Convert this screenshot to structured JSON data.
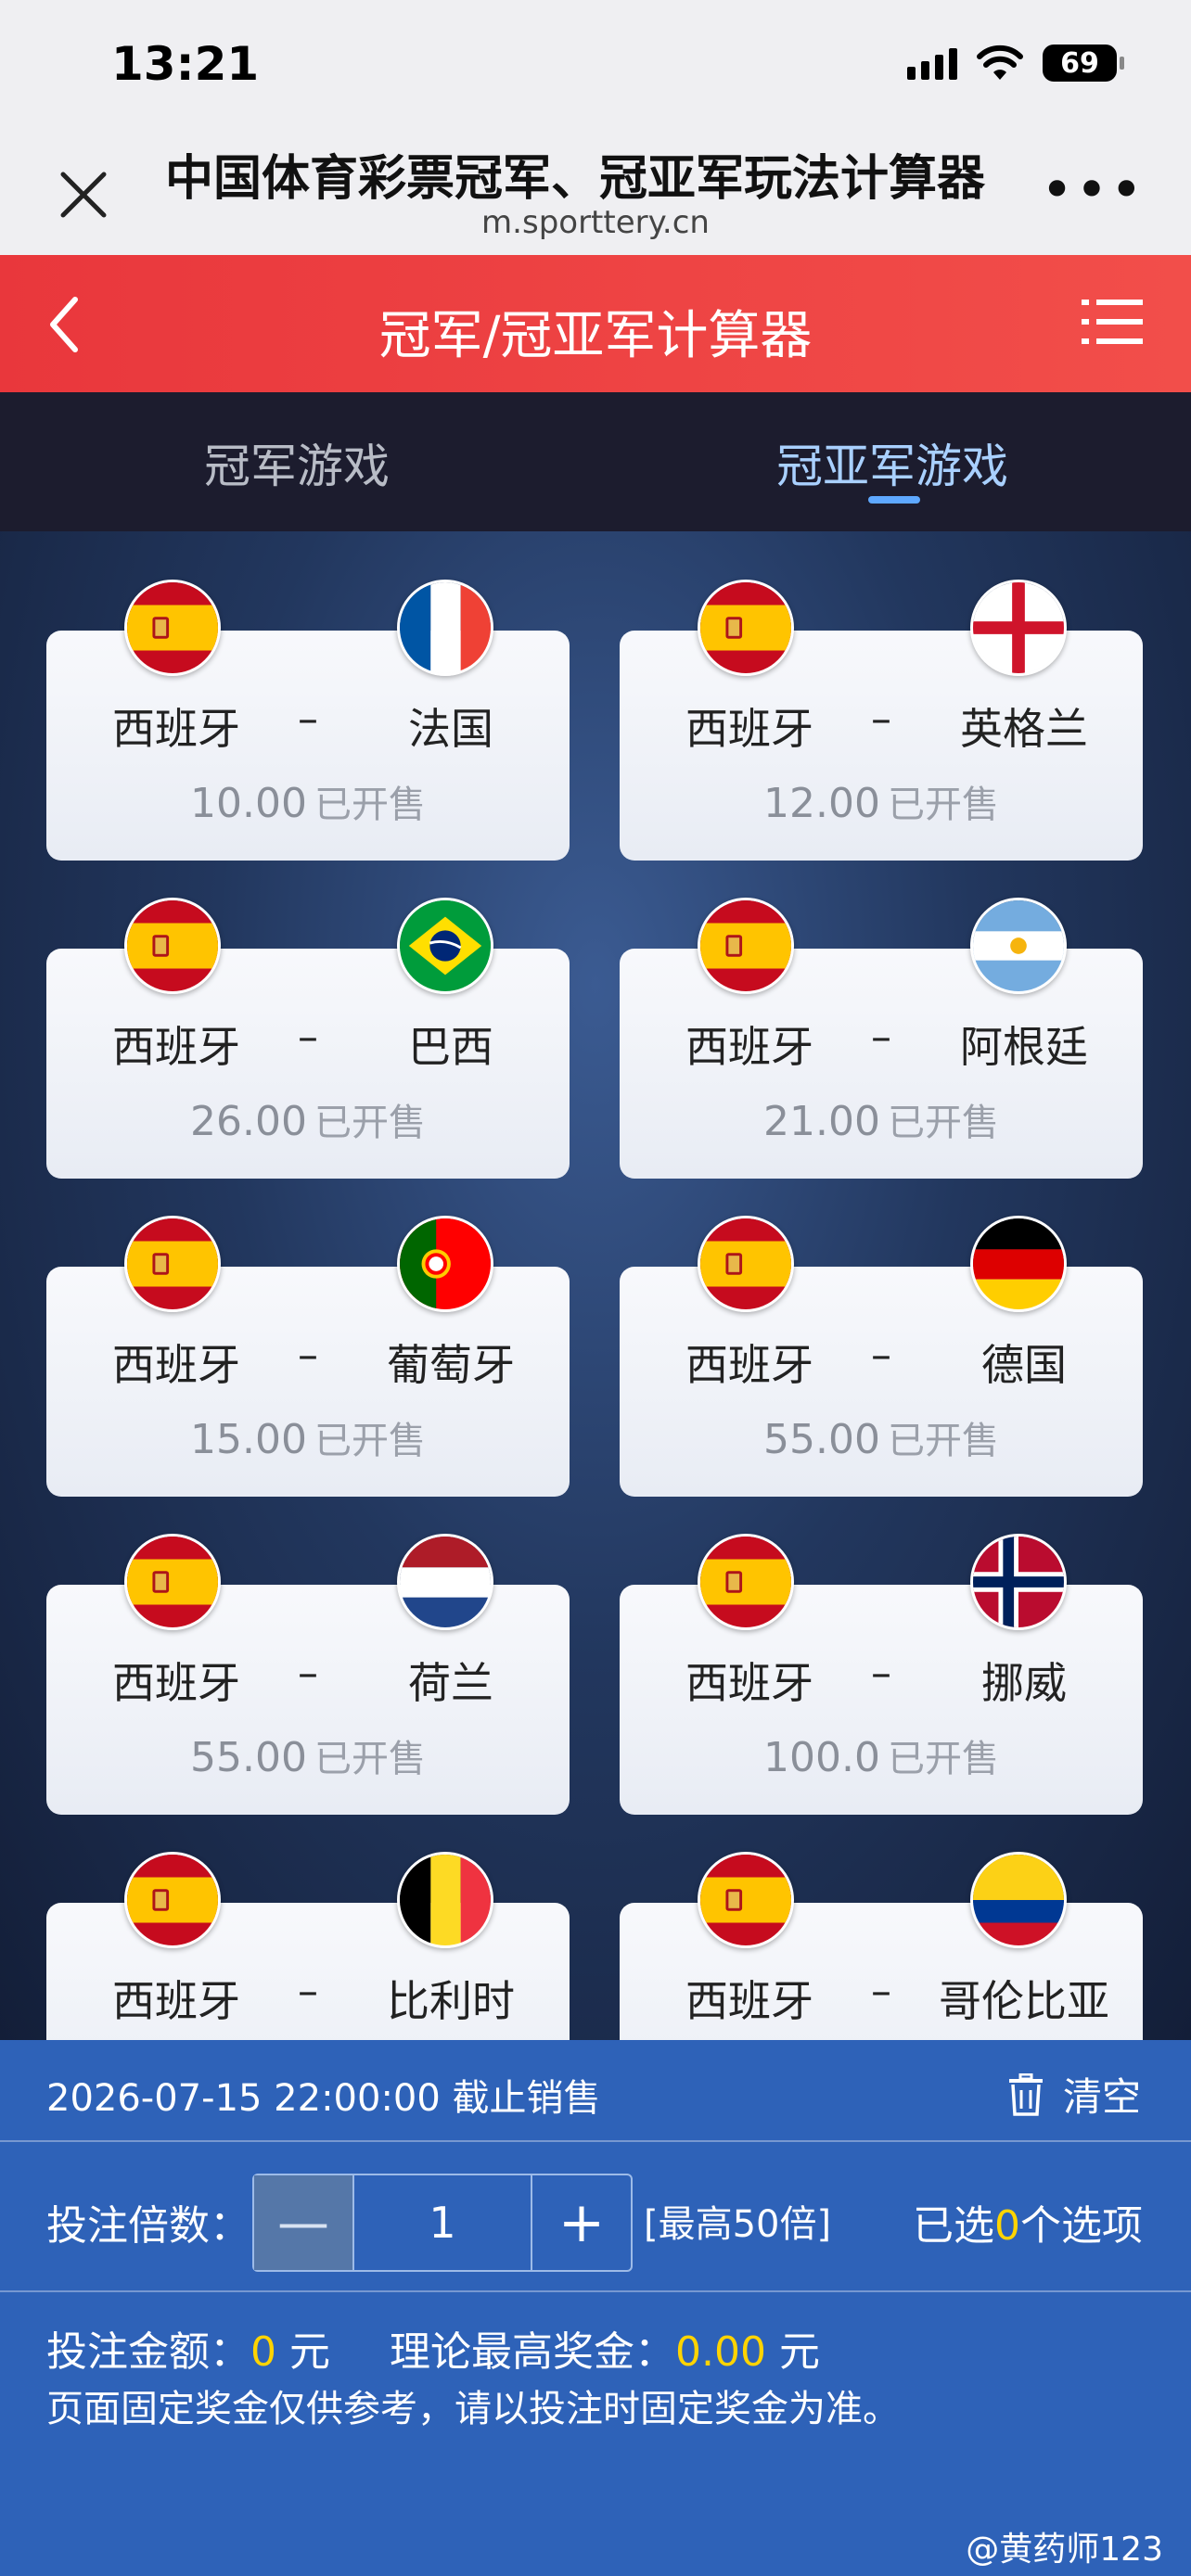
{
  "status_bar": {
    "time": "13:21",
    "battery": "69"
  },
  "browser": {
    "title": "中国体育彩票冠军、冠亚军玩法计算器",
    "url": "m.sporttery.cn",
    "more": "•••"
  },
  "header": {
    "title": "冠军/冠亚军计算器"
  },
  "tabs": [
    {
      "label": "冠军游戏",
      "active": false
    },
    {
      "label": "冠亚军游戏",
      "active": true
    }
  ],
  "matches": [
    {
      "home": "西班牙",
      "away": "法国",
      "sep": "–",
      "odds": "10.00",
      "status": "已开售",
      "home_flag": "spain",
      "away_flag": "france"
    },
    {
      "home": "西班牙",
      "away": "英格兰",
      "sep": "–",
      "odds": "12.00",
      "status": "已开售",
      "home_flag": "spain",
      "away_flag": "england"
    },
    {
      "home": "西班牙",
      "away": "巴西",
      "sep": "–",
      "odds": "26.00",
      "status": "已开售",
      "home_flag": "spain",
      "away_flag": "brazil"
    },
    {
      "home": "西班牙",
      "away": "阿根廷",
      "sep": "–",
      "odds": "21.00",
      "status": "已开售",
      "home_flag": "spain",
      "away_flag": "argentina"
    },
    {
      "home": "西班牙",
      "away": "葡萄牙",
      "sep": "–",
      "odds": "15.00",
      "status": "已开售",
      "home_flag": "spain",
      "away_flag": "portugal"
    },
    {
      "home": "西班牙",
      "away": "德国",
      "sep": "–",
      "odds": "55.00",
      "status": "已开售",
      "home_flag": "spain",
      "away_flag": "germany"
    },
    {
      "home": "西班牙",
      "away": "荷兰",
      "sep": "–",
      "odds": "55.00",
      "status": "已开售",
      "home_flag": "spain",
      "away_flag": "netherlands"
    },
    {
      "home": "西班牙",
      "away": "挪威",
      "sep": "–",
      "odds": "100.0",
      "status": "已开售",
      "home_flag": "spain",
      "away_flag": "norway"
    },
    {
      "home": "西班牙",
      "away": "比利时",
      "sep": "–",
      "odds": "",
      "status": "",
      "home_flag": "spain",
      "away_flag": "belgium"
    },
    {
      "home": "西班牙",
      "away": "哥伦比亚",
      "sep": "–",
      "odds": "",
      "status": "",
      "home_flag": "spain",
      "away_flag": "colombia"
    }
  ],
  "bottom": {
    "deadline": "2026-07-15 22:00:00 截止销售",
    "clear": "清空",
    "multiplier_label": "投注倍数：",
    "minus": "—",
    "multiplier_value": "1",
    "plus": "+",
    "max_multiplier": "[最高50倍]",
    "selected_prefix": "已选",
    "selected_count": "0",
    "selected_suffix": "个选项",
    "amount_label": "投注金额：",
    "amount_value": "0",
    "amount_unit": "元",
    "prize_label": "理论最高奖金：",
    "prize_value": "0.00",
    "prize_unit": "元",
    "note": "页面固定奖金仅供参考，请以投注时固定奖金为准。"
  },
  "watermark": "@黄药师123",
  "colors": {
    "header_red": "#ee4444",
    "panel_blue": "#2e62b8",
    "highlight_yellow": "#ffd400",
    "active_tab": "#a9d0ff"
  }
}
